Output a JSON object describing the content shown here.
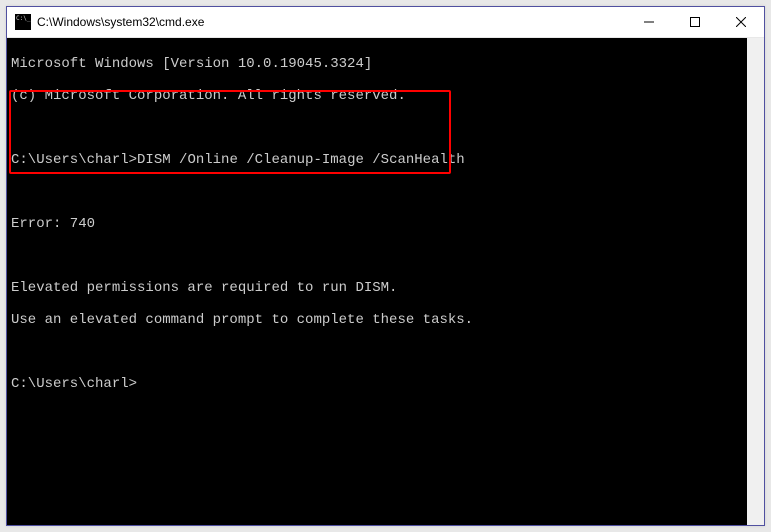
{
  "window": {
    "title": "C:\\Windows\\system32\\cmd.exe"
  },
  "console": {
    "banner_line1": "Microsoft Windows [Version 10.0.19045.3324]",
    "banner_line2": "(c) Microsoft Corporation. All rights reserved.",
    "prompt1_path": "C:\\Users\\charl>",
    "prompt1_command": "DISM /Online /Cleanup-Image /ScanHealth",
    "error_line1": "Error: 740",
    "error_line2": "Elevated permissions are required to run DISM.",
    "error_line3": "Use an elevated command prompt to complete these tasks.",
    "prompt2_path": "C:\\Users\\charl>"
  }
}
